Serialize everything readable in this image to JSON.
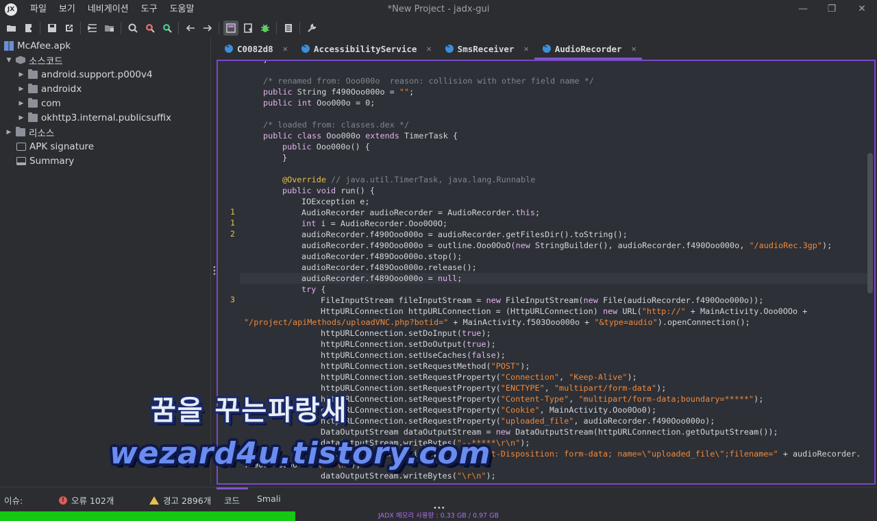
{
  "window": {
    "title": "*New Project - jadx-gui"
  },
  "menu": [
    "파일",
    "보기",
    "네비게이션",
    "도구",
    "도움말"
  ],
  "toolbar": {
    "icons": [
      "open-folder-icon",
      "add-files-icon",
      "save-icon",
      "export-icon",
      "sync-icon",
      "collapse-icon",
      "search-icon",
      "find-class-icon",
      "find-usage-icon",
      "back-icon",
      "forward-icon",
      "decompile-icon",
      "deobfuscate-icon",
      "debug-icon",
      "log-icon",
      "settings-icon"
    ]
  },
  "tree": {
    "root": "McAfee.apk",
    "source_node": "소스코드",
    "packages": [
      "android.support.p000v4",
      "androidx",
      "com",
      "okhttp3.internal.publicsuffix"
    ],
    "resources": "리소스",
    "signature": "APK signature",
    "summary": "Summary"
  },
  "tabs": [
    {
      "label": "C0082d8",
      "close": "✕"
    },
    {
      "label": "AccessibilityService",
      "close": "✕"
    },
    {
      "label": "SmsReceiver",
      "close": "✕"
    },
    {
      "label": "AudioRecorder",
      "close": "✕"
    }
  ],
  "gutter_numbers": [
    "1",
    "1",
    "2",
    "3"
  ],
  "status": {
    "issues_label": "이슈:",
    "errors": "오류 102개",
    "warnings": "경고 2896개",
    "tab_code": "코드",
    "tab_smali": "Smali",
    "memory": "JADX 메모리 사용량 : 0.33 GB / 0.97 GB",
    "memory_fraction": 0.337
  },
  "watermark": {
    "line1": "꿈을 꾸는파랑새",
    "line2": "wezard4u.tistory.com"
  },
  "colors": {
    "accent": "#7f56c9",
    "memory_bar": "#14c814",
    "line_number": "#e6c14a",
    "string": "#f0893c"
  }
}
